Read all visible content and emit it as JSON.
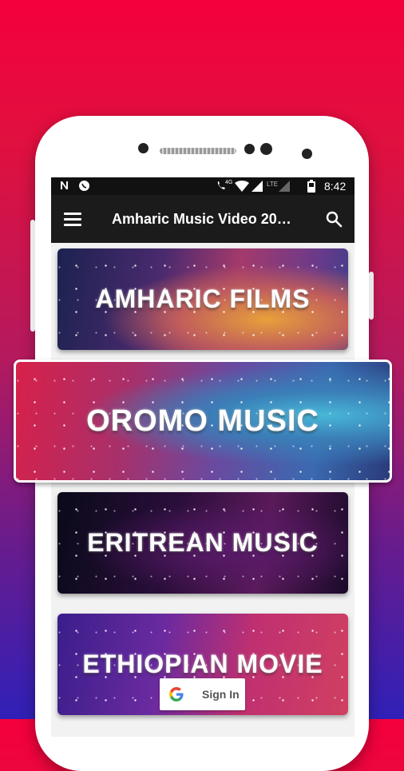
{
  "status_bar": {
    "left_icons": [
      "n-notification-icon",
      "whatsapp-icon"
    ],
    "right_icons": [
      "call-hd-icon",
      "wifi-icon",
      "signal-icon",
      "lte-signal-icon",
      "battery-icon"
    ],
    "hd_label": "4G",
    "lte_label": "LTE",
    "time": "8:42"
  },
  "app_bar": {
    "title": "Amharic Music Video 20…",
    "menu_icon": "hamburger-menu-icon",
    "search_icon": "search-icon"
  },
  "cards": [
    {
      "label": "AMHARIC FILMS"
    },
    {
      "label": "OROMO MUSIC"
    },
    {
      "label": "ERITREAN MUSIC"
    },
    {
      "label": "ETHIOPIAN MOVIE"
    }
  ],
  "sign_in": {
    "label": "Sign In",
    "icon": "google-g-icon"
  },
  "colors": {
    "background_top": "#f4003c",
    "background_bottom": "#3020b8",
    "app_bar": "#1b1b1b",
    "status_bar": "#111111"
  }
}
